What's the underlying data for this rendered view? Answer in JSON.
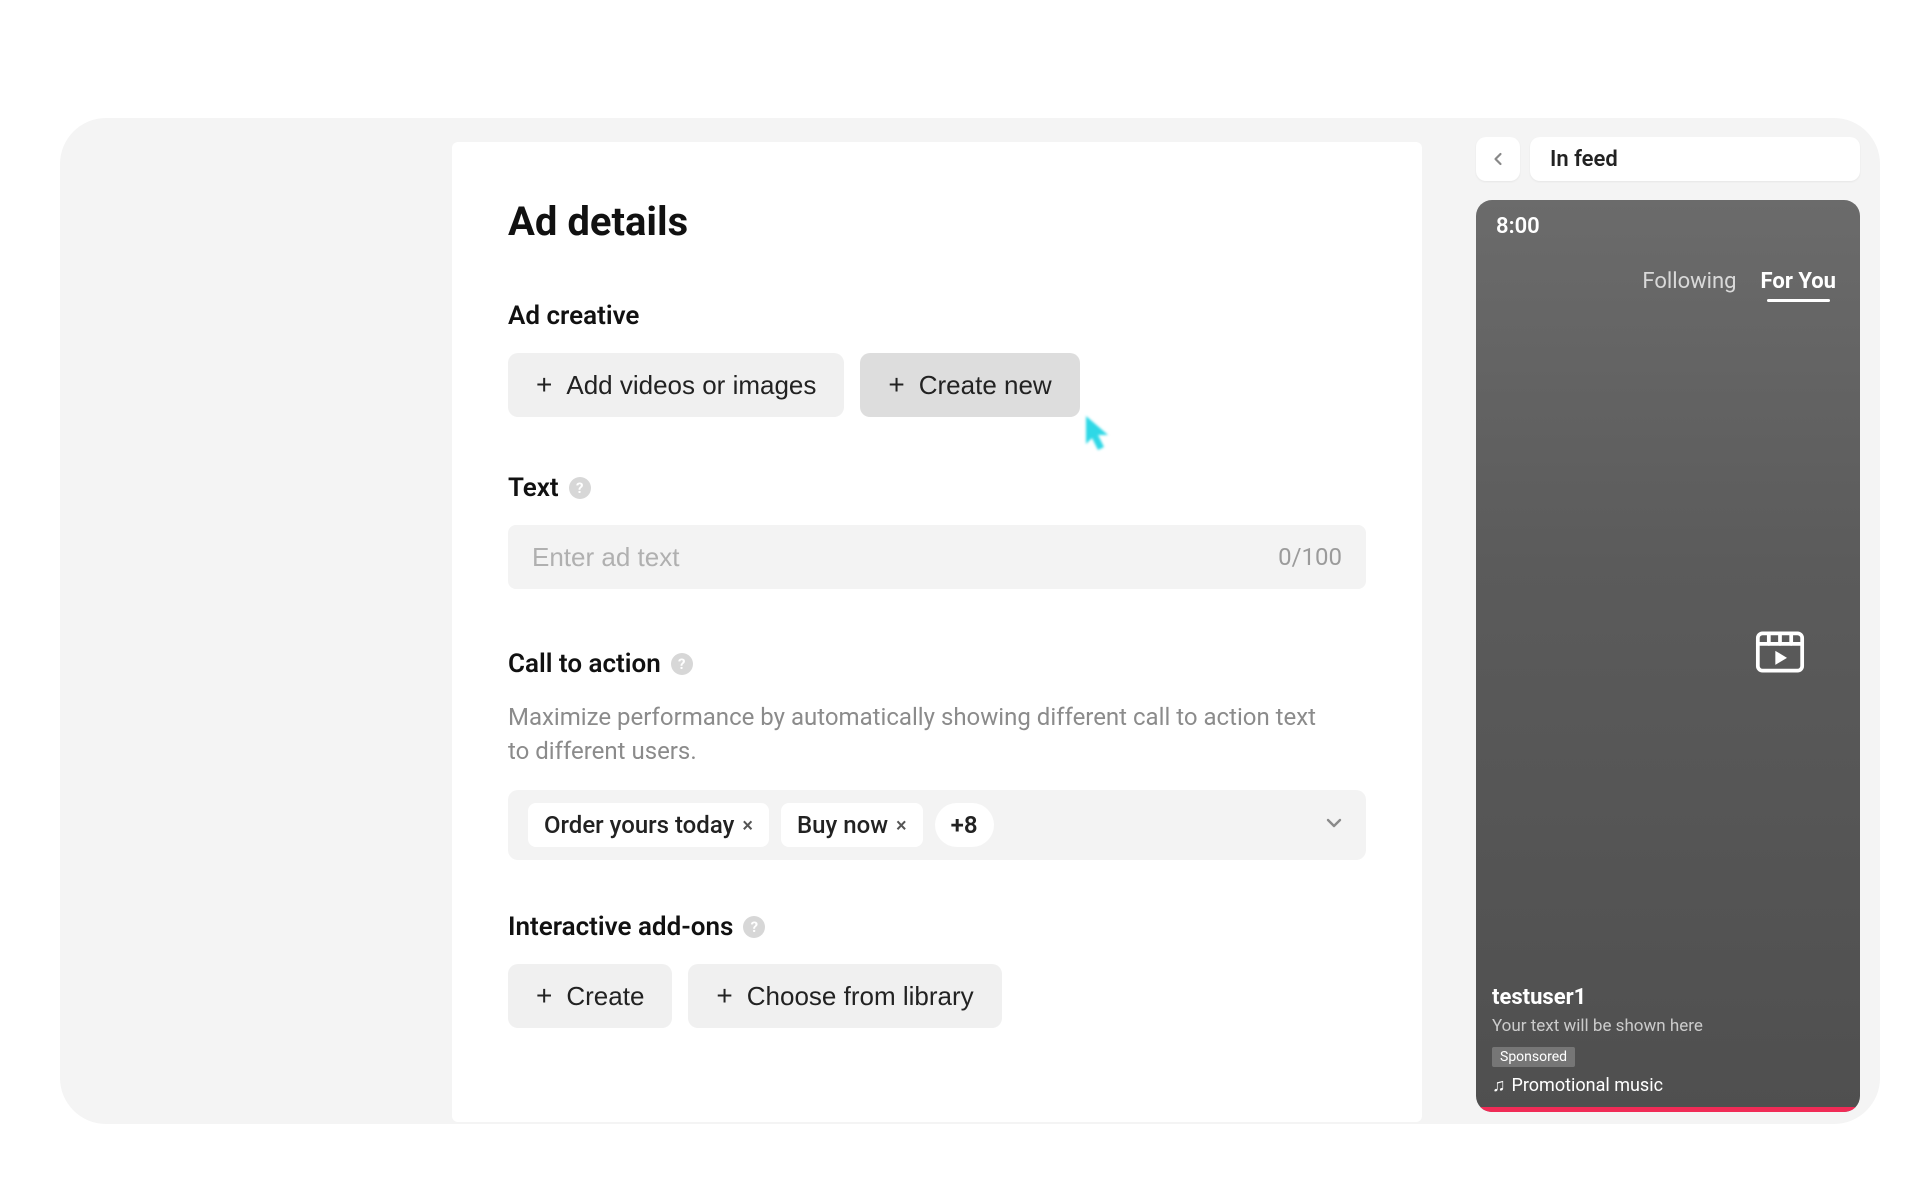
{
  "page": {
    "title": "Ad details"
  },
  "ad_creative": {
    "label": "Ad creative",
    "add_button": "Add videos or images",
    "create_button": "Create new"
  },
  "text": {
    "label": "Text",
    "placeholder": "Enter ad text",
    "counter": "0/100"
  },
  "cta": {
    "label": "Call to action",
    "description": "Maximize performance by automatically showing different call to action text to different users.",
    "chips": [
      "Order yours today",
      "Buy now"
    ],
    "more_count": "+8"
  },
  "addons": {
    "label": "Interactive add-ons",
    "create_button": "Create",
    "library_button": "Choose from library"
  },
  "preview": {
    "back_icon": "‹",
    "mode_label": "In feed",
    "time": "8:00",
    "tabs": {
      "following": "Following",
      "for_you": "For You"
    },
    "username": "testuser1",
    "text_placeholder": "Your text will be shown here",
    "sponsored_badge": "Sponsored",
    "music_label": "Promotional music"
  }
}
